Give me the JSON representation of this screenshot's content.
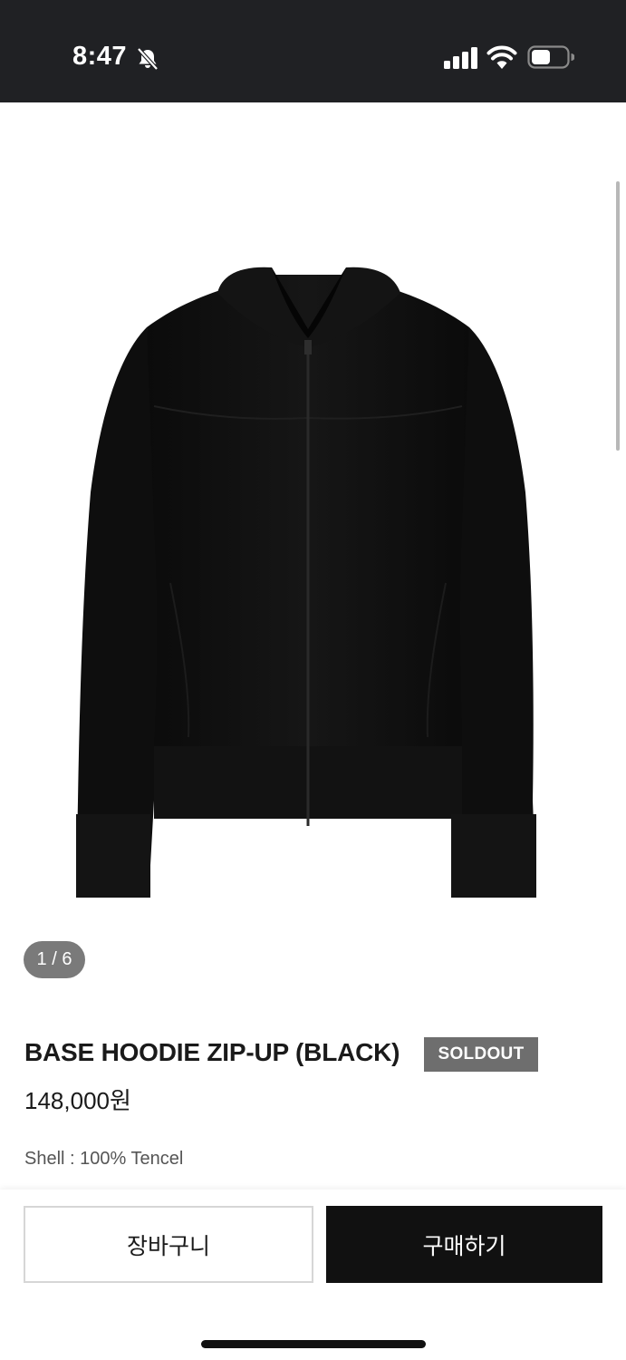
{
  "status_bar": {
    "time": "8:47",
    "icons": [
      "bell-slash-icon",
      "signal-icon",
      "wifi-icon",
      "battery-icon"
    ]
  },
  "gallery": {
    "image_subject": "black hoodie zip-up",
    "page_counter": "1 / 6"
  },
  "product": {
    "title": "BASE HOODIE ZIP-UP (BLACK)",
    "badge": "SOLDOUT",
    "price": "148,000원",
    "material": "Shell : 100% Tencel"
  },
  "actions": {
    "cart_label": "장바구니",
    "buy_label": "구매하기"
  },
  "colors": {
    "status_bar_bg": "#202124",
    "badge_bg": "#6e6e6e",
    "buy_button_bg": "#111111"
  }
}
